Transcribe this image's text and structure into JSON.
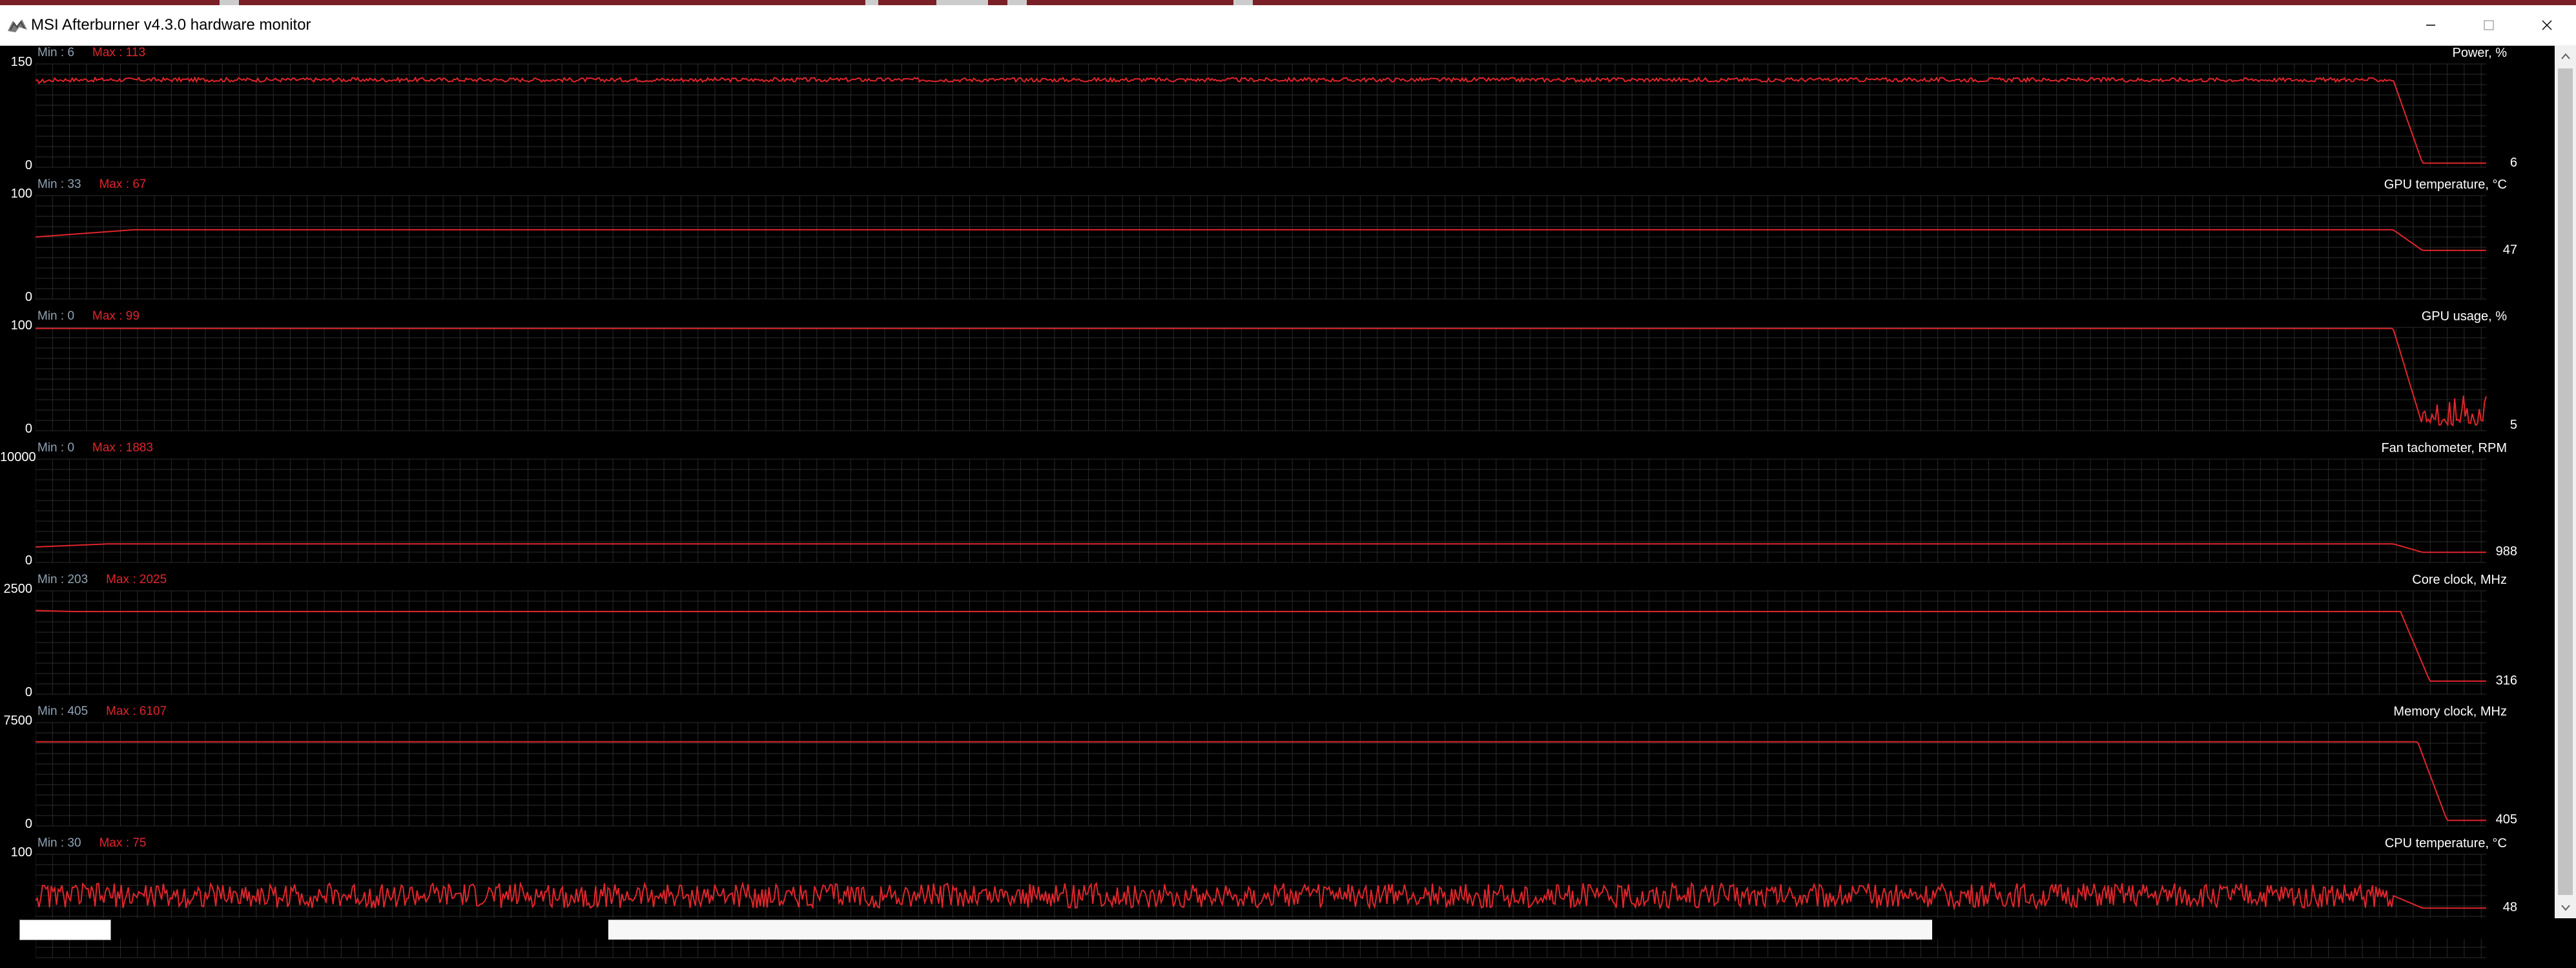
{
  "window": {
    "title": "MSI Afterburner v4.3.0 hardware monitor",
    "minimize_glyph": "—",
    "maximize_glyph": "☐",
    "close_glyph": "✕"
  },
  "colors": {
    "graph_line": "#e0262c",
    "grid": "#2b2b2b",
    "min_label": "#8fa3b5",
    "max_label": "#e0262c",
    "background": "#000000"
  },
  "graphs": [
    {
      "title": "Power, %",
      "min_text": "Min : 6",
      "max_text": "Max : 113",
      "y_top": "150",
      "y_bottom": "0",
      "current": "6",
      "ymax": 150,
      "profile": {
        "plateau": 127,
        "start": 124,
        "end": 6,
        "drop_at": 0.962,
        "ramp": 0.008,
        "noise": 3
      }
    },
    {
      "title": "GPU temperature, °C",
      "min_text": "Min : 33",
      "max_text": "Max : 67",
      "y_top": "100",
      "y_bottom": "0",
      "current": "47",
      "ymax": 100,
      "profile": {
        "plateau": 67,
        "start": 60,
        "end": 47,
        "drop_at": 0.962,
        "ramp": 0.04,
        "noise": 0
      }
    },
    {
      "title": "GPU usage, %",
      "min_text": "Min : 0",
      "max_text": "Max : 99",
      "y_top": "100",
      "y_bottom": "0",
      "current": "5",
      "ymax": 100,
      "profile": {
        "plateau": 99,
        "start": 99,
        "end": 5,
        "drop_at": 0.962,
        "ramp": 0.002,
        "noise": 0,
        "spiky_tail": 35
      }
    },
    {
      "title": "Fan tachometer, RPM",
      "min_text": "Min : 0",
      "max_text": "Max : 1883",
      "y_top": "10000",
      "y_bottom": "0",
      "current": "988",
      "ymax": 10000,
      "profile": {
        "plateau": 1800,
        "start": 1500,
        "end": 988,
        "drop_at": 0.962,
        "ramp": 0.03,
        "noise": 0
      }
    },
    {
      "title": "Core clock, MHz",
      "min_text": "Min : 203",
      "max_text": "Max : 2025",
      "y_top": "2500",
      "y_bottom": "0",
      "current": "316",
      "ymax": 2500,
      "profile": {
        "plateau": 2000,
        "start": 2025,
        "end": 316,
        "drop_at": 0.965,
        "ramp": 0.015,
        "noise": 0
      }
    },
    {
      "title": "Memory clock, MHz",
      "min_text": "Min : 405",
      "max_text": "Max : 6107",
      "y_top": "7500",
      "y_bottom": "0",
      "current": "405",
      "ymax": 7500,
      "profile": {
        "plateau": 6107,
        "start": 6107,
        "end": 405,
        "drop_at": 0.972,
        "ramp": 0.002,
        "noise": 0
      }
    },
    {
      "title": "CPU temperature, °C",
      "min_text": "Min : 30",
      "max_text": "Max : 75",
      "y_top": "100",
      "y_bottom": "",
      "current": "48",
      "ymax": 100,
      "profile": {
        "plateau": 60,
        "start": 60,
        "end": 48,
        "drop_at": 0.962,
        "ramp": 0.01,
        "noise": 12
      }
    }
  ]
}
